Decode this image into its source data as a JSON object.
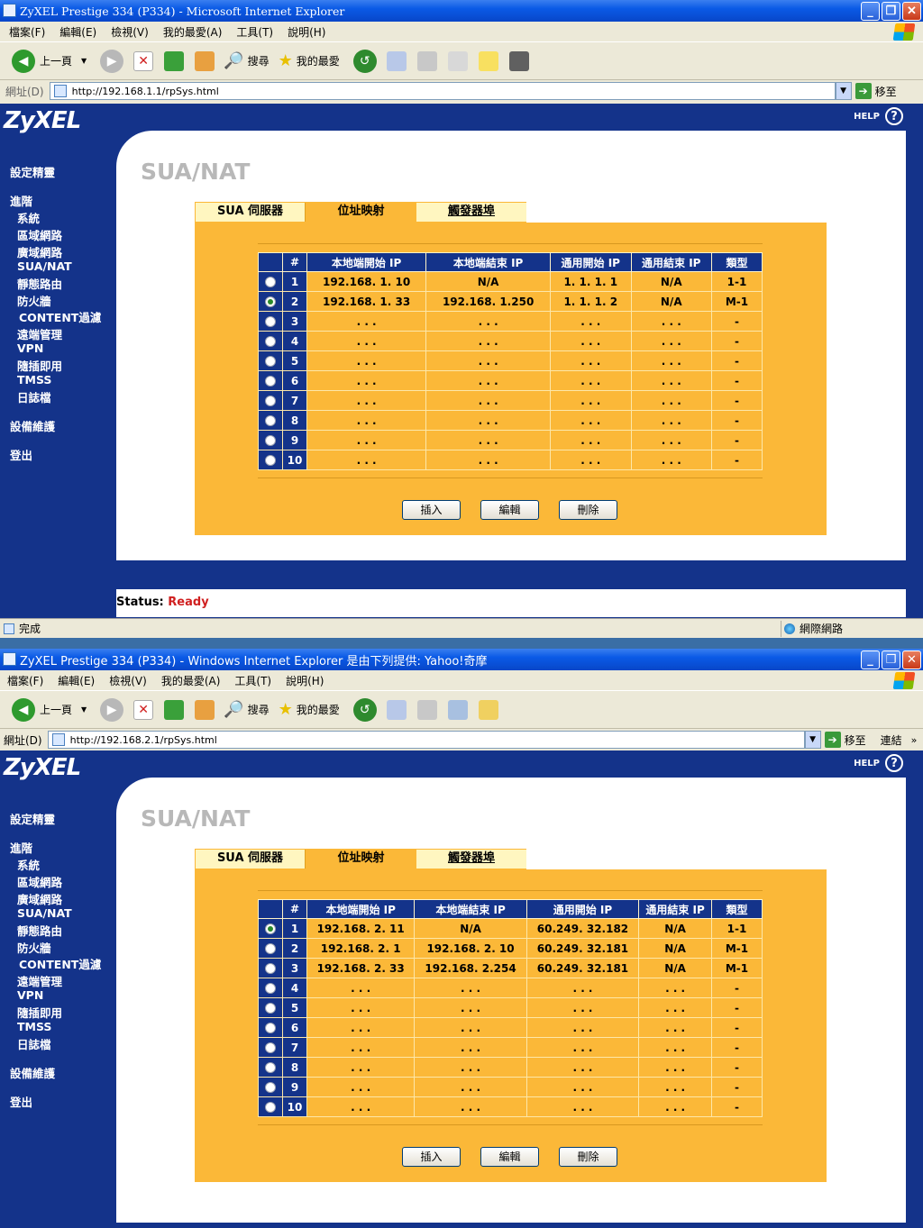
{
  "window1": {
    "title": "ZyXEL Prestige 334 (P334) - Microsoft Internet Explorer",
    "menu": [
      "檔案(F)",
      "編輯(E)",
      "檢視(V)",
      "我的最愛(A)",
      "工具(T)",
      "說明(H)"
    ],
    "toolbar": {
      "back": "上一頁",
      "search": "搜尋",
      "favorites": "我的最愛"
    },
    "address_label": "網址(D)",
    "address": "http://192.168.1.1/rpSys.html",
    "go": "移至",
    "ie_status": "完成",
    "zone": "網際網路",
    "rows": [
      {
        "num": "1",
        "lstart": "192.168. 1. 10",
        "lend": "N/A",
        "gstart": "1. 1. 1. 1",
        "gend": "N/A",
        "type": "1-1",
        "selected": false
      },
      {
        "num": "2",
        "lstart": "192.168. 1. 33",
        "lend": "192.168. 1.250",
        "gstart": "1. 1. 1. 2",
        "gend": "N/A",
        "type": "M-1",
        "selected": true
      },
      {
        "num": "3",
        "lstart": ". . .",
        "lend": ". . .",
        "gstart": ". . .",
        "gend": ". . .",
        "type": "-",
        "selected": false
      },
      {
        "num": "4",
        "lstart": ". . .",
        "lend": ". . .",
        "gstart": ". . .",
        "gend": ". . .",
        "type": "-",
        "selected": false
      },
      {
        "num": "5",
        "lstart": ". . .",
        "lend": ". . .",
        "gstart": ". . .",
        "gend": ". . .",
        "type": "-",
        "selected": false
      },
      {
        "num": "6",
        "lstart": ". . .",
        "lend": ". . .",
        "gstart": ". . .",
        "gend": ". . .",
        "type": "-",
        "selected": false
      },
      {
        "num": "7",
        "lstart": ". . .",
        "lend": ". . .",
        "gstart": ". . .",
        "gend": ". . .",
        "type": "-",
        "selected": false
      },
      {
        "num": "8",
        "lstart": ". . .",
        "lend": ". . .",
        "gstart": ". . .",
        "gend": ". . .",
        "type": "-",
        "selected": false
      },
      {
        "num": "9",
        "lstart": ". . .",
        "lend": ". . .",
        "gstart": ". . .",
        "gend": ". . .",
        "type": "-",
        "selected": false
      },
      {
        "num": "10",
        "lstart": ". . .",
        "lend": ". . .",
        "gstart": ". . .",
        "gend": ". . .",
        "type": "-",
        "selected": false
      }
    ],
    "status_label": "Status:",
    "status_value": "Ready"
  },
  "window2": {
    "title": "ZyXEL Prestige 334 (P334) - Windows Internet Explorer 是由下列提供: Yahoo!奇摩",
    "menu": [
      "檔案(F)",
      "編輯(E)",
      "檢視(V)",
      "我的最愛(A)",
      "工具(T)",
      "說明(H)"
    ],
    "toolbar": {
      "back": "上一頁",
      "search": "搜尋",
      "favorites": "我的最愛"
    },
    "address_label": "網址(D)",
    "address": "http://192.168.2.1/rpSys.html",
    "go": "移至",
    "links": "連結",
    "rows": [
      {
        "num": "1",
        "lstart": "192.168. 2. 11",
        "lend": "N/A",
        "gstart": "60.249. 32.182",
        "gend": "N/A",
        "type": "1-1",
        "selected": true
      },
      {
        "num": "2",
        "lstart": "192.168. 2. 1",
        "lend": "192.168. 2. 10",
        "gstart": "60.249. 32.181",
        "gend": "N/A",
        "type": "M-1",
        "selected": false
      },
      {
        "num": "3",
        "lstart": "192.168. 2. 33",
        "lend": "192.168. 2.254",
        "gstart": "60.249. 32.181",
        "gend": "N/A",
        "type": "M-1",
        "selected": false
      },
      {
        "num": "4",
        "lstart": ". . .",
        "lend": ". . .",
        "gstart": ". . .",
        "gend": ". . .",
        "type": "-",
        "selected": false
      },
      {
        "num": "5",
        "lstart": ". . .",
        "lend": ". . .",
        "gstart": ". . .",
        "gend": ". . .",
        "type": "-",
        "selected": false
      },
      {
        "num": "6",
        "lstart": ". . .",
        "lend": ". . .",
        "gstart": ". . .",
        "gend": ". . .",
        "type": "-",
        "selected": false
      },
      {
        "num": "7",
        "lstart": ". . .",
        "lend": ". . .",
        "gstart": ". . .",
        "gend": ". . .",
        "type": "-",
        "selected": false
      },
      {
        "num": "8",
        "lstart": ". . .",
        "lend": ". . .",
        "gstart": ". . .",
        "gend": ". . .",
        "type": "-",
        "selected": false
      },
      {
        "num": "9",
        "lstart": ". . .",
        "lend": ". . .",
        "gstart": ". . .",
        "gend": ". . .",
        "type": "-",
        "selected": false
      },
      {
        "num": "10",
        "lstart": ". . .",
        "lend": ". . .",
        "gstart": ". . .",
        "gend": ". . .",
        "type": "-",
        "selected": false
      }
    ]
  },
  "router": {
    "logo": "ZyXEL",
    "help": "HELP",
    "page_title": "SUA/NAT",
    "tabs": [
      "SUA 伺服器",
      "位址映射",
      "觸發器埠"
    ],
    "nav": {
      "wizard": "設定精靈",
      "advanced": "進階",
      "items": [
        "系統",
        "區域網路",
        "廣域網路",
        "SUA/NAT",
        "靜態路由",
        "防火牆",
        "CONTENT過濾",
        "遠端管理",
        "VPN",
        "隨插即用",
        "TMSS",
        "日誌檔"
      ],
      "maintenance": "設備維護",
      "logout": "登出"
    },
    "columns": [
      "#",
      "本地端開始 IP",
      "本地端結束 IP",
      "通用開始 IP",
      "通用結束 IP",
      "類型"
    ],
    "buttons": {
      "insert": "插入",
      "edit": "編輯",
      "delete": "刪除"
    }
  },
  "colors": {
    "brand_blue": "#14338a",
    "orange": "#fbb838",
    "status_ready": "#d02020"
  }
}
